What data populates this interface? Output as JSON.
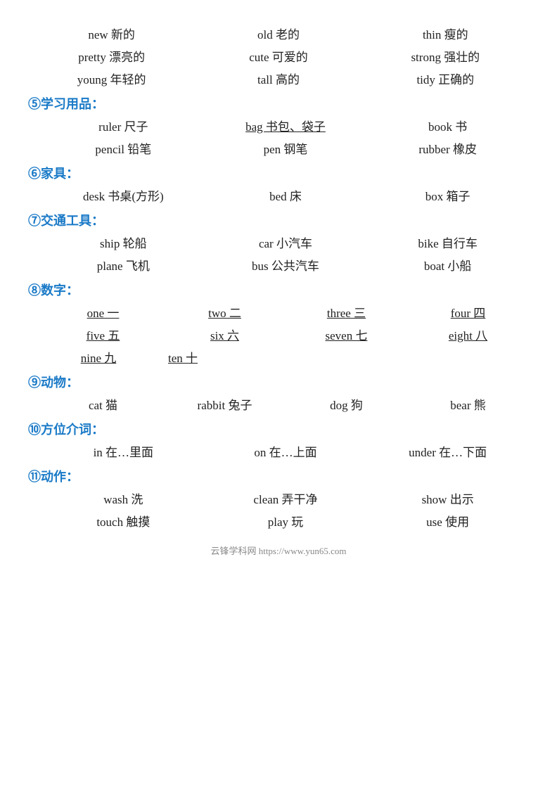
{
  "page": {
    "footer": "云锋学科网 https://www.yun65.com"
  },
  "adjectives": {
    "rows": [
      [
        {
          "text": "new 新的",
          "underline": false
        },
        {
          "text": "old 老的",
          "underline": false
        },
        {
          "text": "thin 瘦的",
          "underline": false
        }
      ],
      [
        {
          "text": "pretty 漂亮的",
          "underline": false
        },
        {
          "text": "cute 可爱的",
          "underline": false
        },
        {
          "text": "strong 强壮的",
          "underline": false
        }
      ],
      [
        {
          "text": "young 年轻的",
          "underline": false
        },
        {
          "text": "tall 高的",
          "underline": false
        },
        {
          "text": "tidy 正确的",
          "underline": false
        }
      ]
    ]
  },
  "sections": [
    {
      "id": "s5",
      "header": "⑤学习用品：",
      "rows": [
        [
          {
            "text": "ruler 尺子",
            "underline": false
          },
          {
            "text": "bag 书包、袋子",
            "underline": true
          },
          {
            "text": "book 书",
            "underline": false
          }
        ],
        [
          {
            "text": "pencil 铅笔",
            "underline": false
          },
          {
            "text": "pen 钢笔",
            "underline": false
          },
          {
            "text": "rubber 橡皮",
            "underline": false
          }
        ]
      ]
    },
    {
      "id": "s6",
      "header": "⑥家具：",
      "rows": [
        [
          {
            "text": "desk 书桌(方形)",
            "underline": false
          },
          {
            "text": "bed 床",
            "underline": false
          },
          {
            "text": "box 箱子",
            "underline": false
          }
        ]
      ]
    },
    {
      "id": "s7",
      "header": "⑦交通工具：",
      "rows": [
        [
          {
            "text": "ship 轮船",
            "underline": false
          },
          {
            "text": "car 小汽车",
            "underline": false
          },
          {
            "text": "bike 自行车",
            "underline": false
          }
        ],
        [
          {
            "text": "plane 飞机",
            "underline": false
          },
          {
            "text": "bus 公共汽车",
            "underline": false
          },
          {
            "text": "boat 小船",
            "underline": false
          }
        ]
      ]
    },
    {
      "id": "s8",
      "header": "⑧数字：",
      "rows_four": [
        [
          {
            "text": "one 一",
            "underline": true
          },
          {
            "text": "two 二",
            "underline": true
          },
          {
            "text": "three 三",
            "underline": true
          },
          {
            "text": "four 四",
            "underline": true
          }
        ],
        [
          {
            "text": "five 五",
            "underline": true
          },
          {
            "text": "six 六",
            "underline": true
          },
          {
            "text": "seven 七",
            "underline": true
          },
          {
            "text": "eight 八",
            "underline": true
          }
        ],
        [
          {
            "text": "nine 九",
            "underline": true
          },
          {
            "text": "ten 十",
            "underline": true
          },
          {
            "text": "",
            "underline": false
          },
          {
            "text": "",
            "underline": false
          }
        ]
      ]
    },
    {
      "id": "s9",
      "header": "⑨动物：",
      "rows_four": [
        [
          {
            "text": "cat 猫",
            "underline": false
          },
          {
            "text": "rabbit 兔子",
            "underline": false
          },
          {
            "text": "dog 狗",
            "underline": false
          },
          {
            "text": "bear 熊",
            "underline": false
          }
        ]
      ]
    },
    {
      "id": "s10",
      "header": "⑩方位介词：",
      "rows": [
        [
          {
            "text": "in 在…里面",
            "underline": false
          },
          {
            "text": "on 在…上面",
            "underline": false
          },
          {
            "text": "under 在…下面",
            "underline": false
          }
        ]
      ]
    },
    {
      "id": "s11",
      "header": "⑪动作：",
      "rows": [
        [
          {
            "text": "wash 洗",
            "underline": false
          },
          {
            "text": "clean 弄干净",
            "underline": false
          },
          {
            "text": "show 出示",
            "underline": false
          }
        ],
        [
          {
            "text": "touch 触摸",
            "underline": false
          },
          {
            "text": "play 玩",
            "underline": false
          },
          {
            "text": "use 使用",
            "underline": false
          }
        ]
      ]
    }
  ]
}
